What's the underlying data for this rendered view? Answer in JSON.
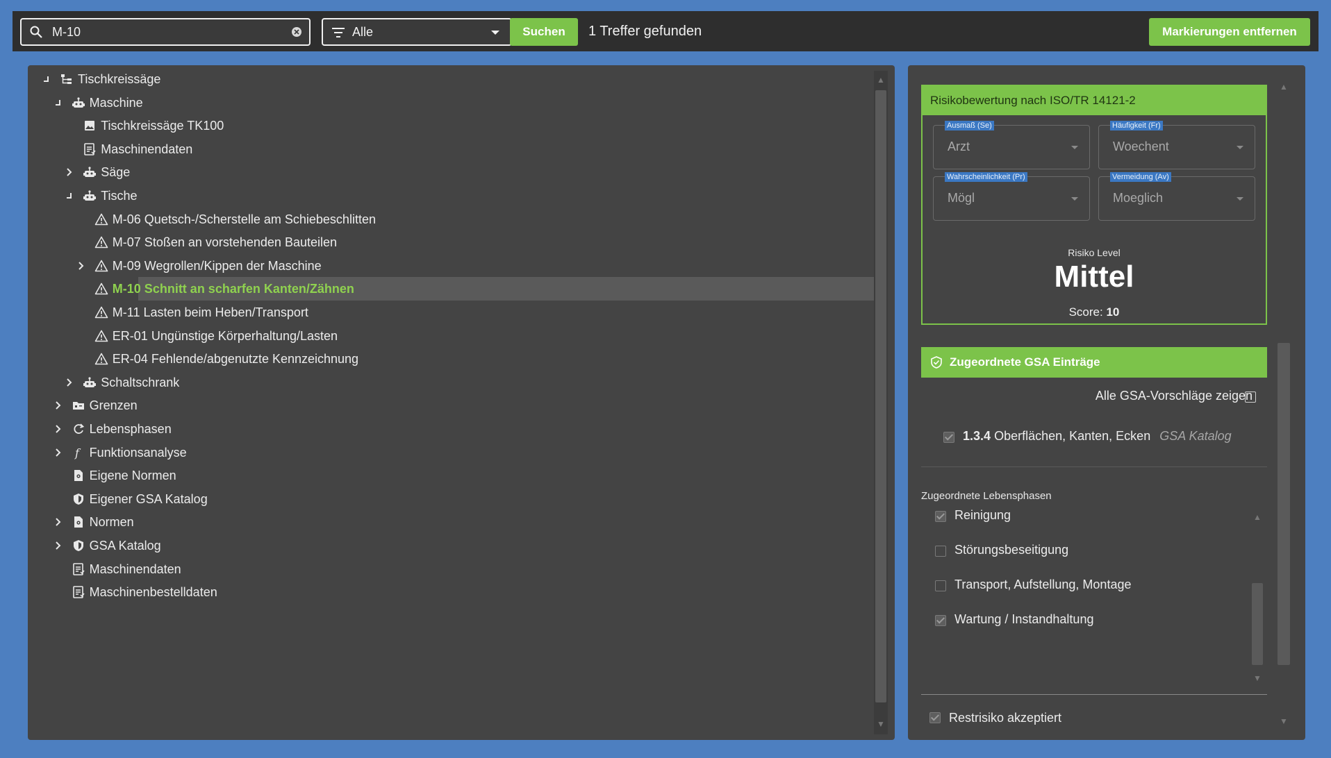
{
  "toolbar": {
    "search_value": "M-10",
    "filter_value": "Alle",
    "search_button": "Suchen",
    "hits_text": "1 Treffer gefunden",
    "clear_marks_button": "Markierungen entfernen",
    "accent_color": "#7cc34a"
  },
  "tree": [
    {
      "label": "Tischkreissäge",
      "icon": "tree-structure-icon",
      "level": 0,
      "state": "expanded"
    },
    {
      "label": "Maschine",
      "icon": "robot-icon",
      "level": 1,
      "state": "expanded"
    },
    {
      "label": "Tischkreissäge TK100",
      "icon": "image-icon",
      "level": 2,
      "state": "leaf"
    },
    {
      "label": "Maschinendaten",
      "icon": "document-list-icon",
      "level": 2,
      "state": "leaf"
    },
    {
      "label": "Säge",
      "icon": "robot-icon",
      "level": 2,
      "state": "collapsed"
    },
    {
      "label": "Tische",
      "icon": "robot-icon",
      "level": 2,
      "state": "expanded"
    },
    {
      "label": "M-06 Quetsch-/Scherstelle am Schiebeschlitten",
      "icon": "warning-icon",
      "level": 3,
      "state": "leaf"
    },
    {
      "label": "M-07 Stoßen an vorstehenden Bauteilen",
      "icon": "warning-icon",
      "level": 3,
      "state": "leaf"
    },
    {
      "label": "M-09 Wegrollen/Kippen der Maschine",
      "icon": "warning-icon",
      "level": 3,
      "state": "collapsed"
    },
    {
      "label": "M-10 Schnitt an scharfen Kanten/Zähnen",
      "icon": "warning-icon",
      "level": 3,
      "state": "leaf",
      "selected": true
    },
    {
      "label": "M-11 Lasten beim Heben/Transport",
      "icon": "warning-icon",
      "level": 3,
      "state": "leaf"
    },
    {
      "label": "ER-01 Ungünstige Körperhaltung/Lasten",
      "icon": "warning-icon",
      "level": 3,
      "state": "leaf"
    },
    {
      "label": "ER-04 Fehlende/abgenutzte Kennzeichnung",
      "icon": "warning-icon",
      "level": 3,
      "state": "leaf"
    },
    {
      "label": "Schaltschrank",
      "icon": "robot-icon",
      "level": 2,
      "state": "collapsed"
    },
    {
      "label": "Grenzen",
      "icon": "folder-icon",
      "level": 1,
      "state": "collapsed"
    },
    {
      "label": "Lebensphasen",
      "icon": "cycle-icon",
      "level": 1,
      "state": "collapsed"
    },
    {
      "label": "Funktionsanalyse",
      "icon": "function-icon",
      "level": 1,
      "state": "collapsed"
    },
    {
      "label": "Eigene Normen",
      "icon": "norm-document-icon",
      "level": 1,
      "state": "leaf"
    },
    {
      "label": "Eigener GSA Katalog",
      "icon": "shield-icon",
      "level": 1,
      "state": "leaf"
    },
    {
      "label": "Normen",
      "icon": "norm-document-icon",
      "level": 1,
      "state": "collapsed"
    },
    {
      "label": "GSA Katalog",
      "icon": "shield-icon",
      "level": 1,
      "state": "collapsed"
    },
    {
      "label": "Maschinendaten",
      "icon": "document-list-icon",
      "level": 1,
      "state": "leaf"
    },
    {
      "label": "Maschinenbestelldaten",
      "icon": "document-list-icon",
      "level": 1,
      "state": "leaf"
    }
  ],
  "risk": {
    "title": "Risikobewertung nach ISO/TR 14121-2",
    "severity_label": "Ausmaß (Se)",
    "severity_value": "Arzt",
    "frequency_label": "Häufigkeit (Fr)",
    "frequency_value": "Woechent",
    "probability_label": "Wahrscheinlichkeit (Pr)",
    "probability_value": "Mögl",
    "avoidance_label": "Vermeidung (Av)",
    "avoidance_value": "Moeglich",
    "level_caption": "Risiko Level",
    "level": "Mittel",
    "score_label": "Score:",
    "score": "10"
  },
  "gsa": {
    "title": "Zugeordnete GSA Einträge",
    "show_all_label": "Alle GSA-Vorschläge zeigen",
    "show_all_checked": false,
    "entry_code": "1.3.4",
    "entry_text": "Oberflächen, Kanten, Ecken",
    "entry_source": "GSA Katalog",
    "entry_checked": true
  },
  "phases": {
    "caption": "Zugeordnete Lebensphasen",
    "items": [
      {
        "label": "Reinigung",
        "checked": true
      },
      {
        "label": "Störungsbeseitigung",
        "checked": false
      },
      {
        "label": "Transport, Aufstellung, Montage",
        "checked": false
      },
      {
        "label": "Wartung / Instandhaltung",
        "checked": true
      }
    ]
  },
  "restrisk": {
    "label": "Restrisiko akzeptiert",
    "checked": true
  }
}
